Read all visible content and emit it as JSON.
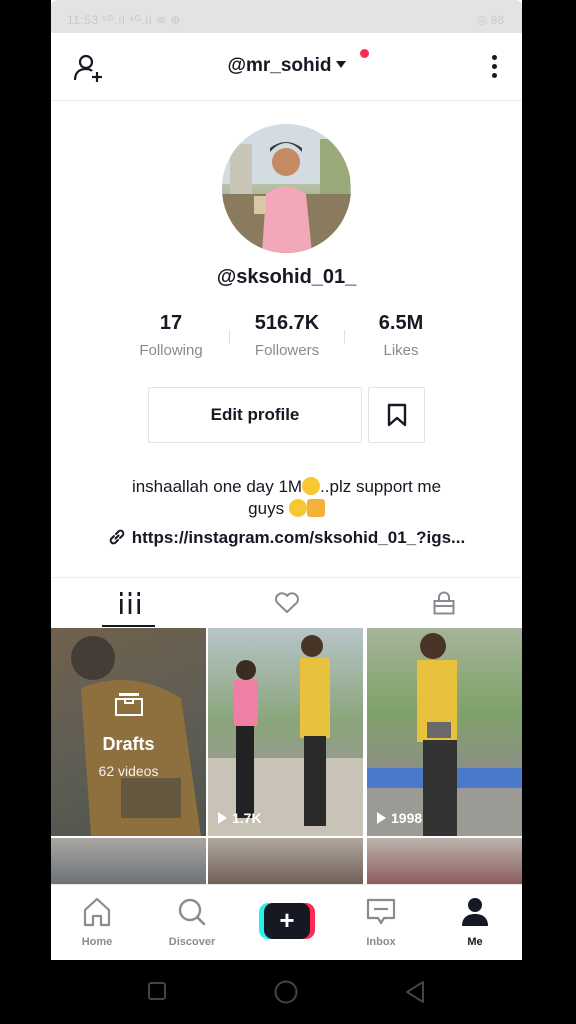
{
  "status_bar": {
    "left": "11:53 ⁵ᴳ.ıl ⁴ᴳ.ıl ≋ ⊕",
    "right": "◎ 98"
  },
  "header": {
    "username": "@mr_sohid",
    "notification_dot_color": "#fe2c55"
  },
  "profile": {
    "handle": "@sksohid_01_",
    "stats": [
      {
        "value": "17",
        "label": "Following"
      },
      {
        "value": "516.7K",
        "label": "Followers"
      },
      {
        "value": "6.5M",
        "label": "Likes"
      }
    ],
    "edit_label": "Edit profile",
    "bio_part1": "inshaallah one day 1M",
    "bio_part2": "..plz support me",
    "bio_part3": "guys",
    "link": "https://instagram.com/sksohid_01_?igs..."
  },
  "tabs": [
    {
      "icon": "grid-icon",
      "active": true
    },
    {
      "icon": "heart-icon",
      "active": false
    },
    {
      "icon": "lock-icon",
      "active": false
    }
  ],
  "grid": {
    "drafts_label": "Drafts",
    "drafts_count": "62 videos",
    "video_views": [
      "1.7K",
      "1998"
    ]
  },
  "bottom_nav": [
    {
      "label": "Home",
      "icon": "home-icon",
      "active": false
    },
    {
      "label": "Discover",
      "icon": "search-icon",
      "active": false
    },
    {
      "label": "",
      "icon": "plus-icon",
      "active": false
    },
    {
      "label": "Inbox",
      "icon": "inbox-icon",
      "active": false
    },
    {
      "label": "Me",
      "icon": "person-icon",
      "active": true
    }
  ],
  "colors": {
    "accent_red": "#fe2c55",
    "accent_cyan": "#25f4ee",
    "text": "#161823",
    "muted": "#8a8b91"
  }
}
